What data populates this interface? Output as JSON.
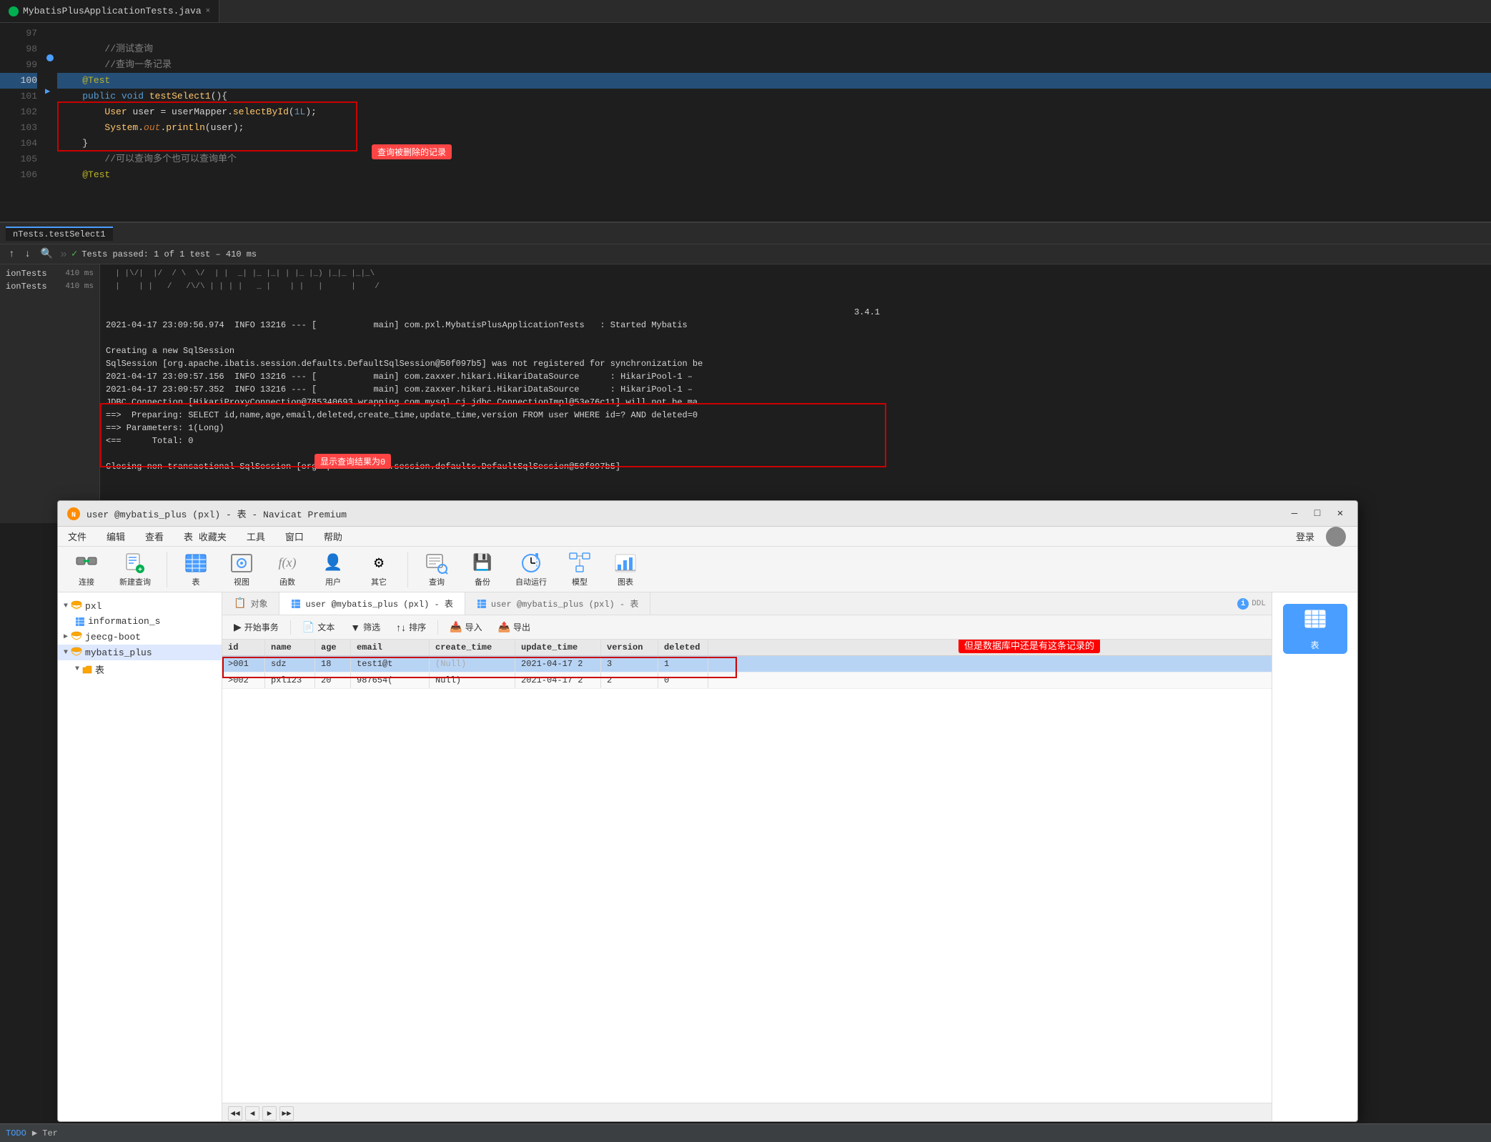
{
  "editor": {
    "tab_label": "MybatisPlusApplicationTests.java",
    "lines": [
      {
        "num": "97",
        "content": "",
        "gutter": false,
        "active": false
      },
      {
        "num": "98",
        "content": "        //测试查询",
        "gutter": false,
        "active": false
      },
      {
        "num": "99",
        "content": "        //查询一条记录",
        "gutter": true,
        "active": false
      },
      {
        "num": "100",
        "content": "    @Test",
        "gutter": false,
        "active": true
      },
      {
        "num": "101",
        "content": "    public void testSelect1(){",
        "gutter": true,
        "active": false
      },
      {
        "num": "102",
        "content": "        User user = userMapper.selectById(1L);",
        "gutter": false,
        "active": false
      },
      {
        "num": "103",
        "content": "        System.out.println(user);",
        "gutter": false,
        "active": false
      },
      {
        "num": "104",
        "content": "    }",
        "gutter": false,
        "active": false
      },
      {
        "num": "105",
        "content": "        //可以查询多个也可以查询单个",
        "gutter": false,
        "active": false
      },
      {
        "num": "106",
        "content": "    @Test",
        "gutter": false,
        "active": false
      }
    ],
    "annotation_text": "查询被删除的记录",
    "close_label": "×"
  },
  "test_panel": {
    "tab_label": "nTests.testSelect1",
    "status_text": "Tests passed: 1 of 1 test – 410 ms",
    "items": [
      {
        "label": "ionTests",
        "duration": "410 ms"
      },
      {
        "label": "ionTests",
        "duration": "410 ms"
      }
    ],
    "console_lines": [
      {
        "text": "  / ___|   __  ___ __   ___|  |_| |_   |_)  |_|_ |_|_ \\",
        "type": "banner"
      },
      {
        "text": "  |    |  / /  \\ /  | | |     |_   _|  |      |   |    /",
        "type": "banner"
      },
      {
        "text": "",
        "type": "normal"
      },
      {
        "text": "                       3.4.1",
        "type": "normal"
      },
      {
        "text": "2021-04-17 23:09:56.974  INFO 13216 --- [           main] com.pxl.MybatisPlusApplicationTests   : Started Mybatis",
        "type": "normal"
      },
      {
        "text": "",
        "type": "normal"
      },
      {
        "text": "Creating a new SqlSession",
        "type": "normal"
      },
      {
        "text": "SqlSession [org.apache.ibatis.session.defaults.DefaultSqlSession@50f097b5] was not registered for synchronization be",
        "type": "normal"
      },
      {
        "text": "2021-04-17 23:09:57.156  INFO 13216 --- [           main] com.zaxxer.hikari.HikariDataSource      : HikariPool-1 –",
        "type": "normal"
      },
      {
        "text": "2021-04-17 23:09:57.352  INFO 13216 --- [           main] com.zaxxer.hikari.HikariDataSource      : HikariPool-1 –",
        "type": "normal"
      },
      {
        "text": "JDBC Connection [HikariProxyConnection@785340693 wrapping com.mysql.cj.jdbc.ConnectionImpl@53e76c11] will not be ma",
        "type": "normal"
      },
      {
        "text": "==>  Preparing: SELECT id,name,age,email,deleted,create_time,update_time,version FROM user WHERE id=? AND deleted=0",
        "type": "arrow"
      },
      {
        "text": "==> Parameters: 1(Long)",
        "type": "arrow"
      },
      {
        "text": "<==      Total: 0",
        "type": "arrow"
      },
      {
        "text": "",
        "type": "normal"
      },
      {
        "text": "Closing non transactional SqlSession [org.apache.ibatis.session.defaults.DefaultSqlSession@50f097b5]",
        "type": "normal"
      }
    ],
    "result_annotation": "显示查询结果为0"
  },
  "navicat": {
    "title": "user @mybatis_plus (pxl) - 表 - Navicat Premium",
    "menu_items": [
      "文件",
      "编辑",
      "查看",
      "表 收藏夹",
      "工具",
      "窗口",
      "帮助"
    ],
    "login_label": "登录",
    "toolbar_buttons": [
      {
        "label": "连接",
        "icon": "🔗"
      },
      {
        "label": "新建查询",
        "icon": "📄"
      },
      {
        "label": "表",
        "icon": "📊"
      },
      {
        "label": "视图",
        "icon": "👁"
      },
      {
        "label": "函数",
        "icon": "f(x)"
      },
      {
        "label": "用户",
        "icon": "👤"
      },
      {
        "label": "其它",
        "icon": "⚙"
      },
      {
        "label": "查询",
        "icon": "🔍"
      },
      {
        "label": "备份",
        "icon": "💾"
      },
      {
        "label": "自动运行",
        "icon": "⏱"
      },
      {
        "label": "模型",
        "icon": "📐"
      },
      {
        "label": "图表",
        "icon": "📈"
      }
    ],
    "sidebar": {
      "items": [
        {
          "label": "pxl",
          "type": "db",
          "expanded": true
        },
        {
          "label": "information_s",
          "type": "table",
          "indent": 1
        },
        {
          "label": "jeecg-boot",
          "type": "db",
          "indent": 0
        },
        {
          "label": "mybatis_plus",
          "type": "db",
          "expanded": true,
          "indent": 0
        },
        {
          "label": "表",
          "type": "folder",
          "indent": 1
        }
      ]
    },
    "tabs": [
      {
        "label": "对象",
        "icon": "📋",
        "active": false
      },
      {
        "label": "user @mybatis_plus (pxl) - 表",
        "icon": "📊",
        "active": true
      },
      {
        "label": "user @mybatis_plus (pxl) - 表",
        "icon": "📊",
        "active": false
      }
    ],
    "action_bar": {
      "buttons": [
        "开始事务",
        "文本",
        "筛选",
        "↑↓ 排序",
        "导入",
        "导出"
      ]
    },
    "table": {
      "headers": [
        "id",
        "name",
        "age",
        "email",
        "create_time",
        "update_time",
        "version",
        "deleted"
      ],
      "rows": [
        {
          "id": ">001",
          "name": "sdz",
          "age": "18",
          "email": "test1@t",
          "create_time": "(Null)",
          "update_time": "2021-04-17 2",
          "version": "3",
          "deleted": "1",
          "highlight": true
        },
        {
          "id": ">002",
          "name": "pxl123",
          "age": "20",
          "email": "987654(",
          "create_time": "Null)",
          "update_time": "2021-04-17 2",
          "version": "2",
          "deleted": "0",
          "highlight": false
        }
      ]
    },
    "table_annotation": "但是数据库中还是有这条记录的",
    "right_panel": {
      "btn_label": "表",
      "btn_icon": "📊"
    }
  },
  "ide_status": {
    "todo_label": "TODO",
    "terminal_label": "▶ Ter"
  }
}
